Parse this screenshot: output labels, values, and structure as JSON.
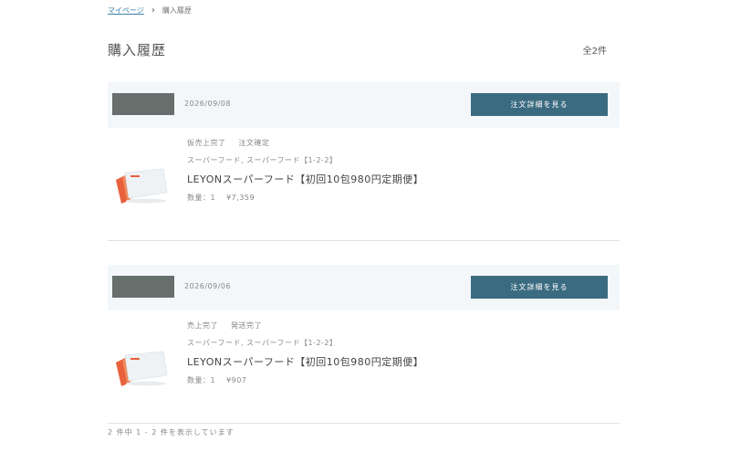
{
  "breadcrumb": {
    "home": "マイページ",
    "current": "購入履歴"
  },
  "title": "購入履歴",
  "total": "全2件",
  "orders": [
    {
      "date": "2026/09/08",
      "detail_label": "注文詳細を見る",
      "status1": "仮売上完了",
      "status2": "注文確定",
      "variant": "スーパーフード, スーパーフード【1-2-2】",
      "name": "LEYONスーパーフード【初回10包980円定期便】",
      "qty": "数量：1",
      "price": "¥7,359"
    },
    {
      "date": "2026/09/06",
      "detail_label": "注文詳細を見る",
      "status1": "売上完了",
      "status2": "発送完了",
      "variant": "スーパーフード, スーパーフード【1-2-2】",
      "name": "LEYONスーパーフード【初回10包980円定期便】",
      "qty": "数量：1",
      "price": "¥907"
    }
  ],
  "footer": "2 件中 1 - 2 件を表示しています",
  "colors": {
    "button": "#3b6b80",
    "header_bg": "#f3f7fa",
    "accent_link": "#3d7fa6"
  }
}
